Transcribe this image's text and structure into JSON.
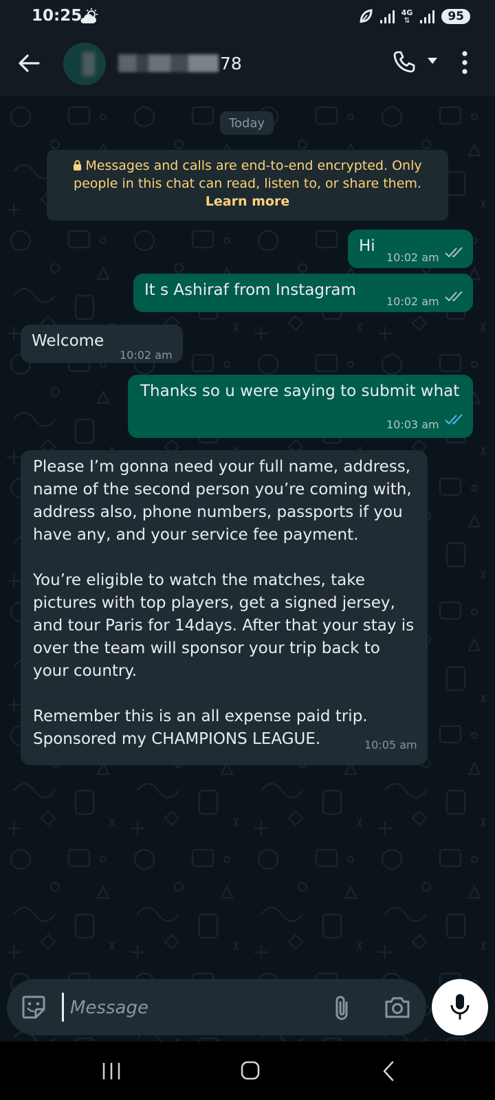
{
  "status_bar": {
    "time": "10:25",
    "network": "4G",
    "battery": "95"
  },
  "header": {
    "contact_suffix": "78"
  },
  "chat": {
    "date_label": "Today",
    "encryption_notice": {
      "text": "Messages and calls are end-to-end encrypted. Only people in this chat can read, listen to, or share them.",
      "link": "Learn more"
    },
    "messages": [
      {
        "direction": "out",
        "text": "Hi",
        "time": "10:02 am",
        "status": "delivered"
      },
      {
        "direction": "out",
        "text": "It s Ashiraf from Instagram",
        "time": "10:02 am",
        "status": "delivered"
      },
      {
        "direction": "in",
        "text": "Welcome",
        "time": "10:02 am"
      },
      {
        "direction": "out",
        "text": "Thanks so u were saying to submit what",
        "time": "10:03 am",
        "status": "read"
      },
      {
        "direction": "in",
        "text": "Please I’m gonna need your full name, address, name of the second person you’re coming with, address also, phone numbers, passports if you have any, and your service fee payment.\n\nYou’re eligible to watch the matches, take pictures with top players, get a signed jersey, and tour Paris for 14days. After that your stay is over the team will sponsor your trip back to your country.\n\nRemember this is an all expense paid trip. Sponsored my CHAMPIONS LEAGUE.",
        "time": "10:05 am"
      }
    ]
  },
  "input": {
    "placeholder": "Message"
  },
  "colors": {
    "background": "#0b141a",
    "header": "#121b22",
    "outgoing_bubble": "#005c4b",
    "incoming_bubble": "#202c33",
    "notice_text": "#ffd279",
    "read_tick": "#53bdeb"
  },
  "icons": [
    "weather-icon",
    "signal-icon",
    "battery-icon",
    "back-icon",
    "call-icon",
    "menu-icon",
    "lock-icon",
    "double-tick-icon",
    "emoji-icon",
    "attach-icon",
    "camera-icon",
    "mic-icon",
    "nav-recents-icon",
    "nav-home-icon",
    "nav-back-icon"
  ]
}
